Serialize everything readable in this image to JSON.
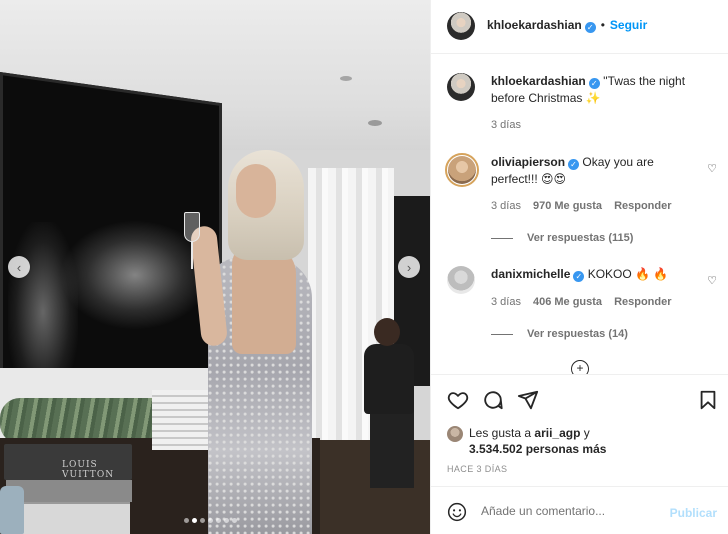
{
  "post": {
    "author": "khloekardashian",
    "follow_label": "Seguir",
    "separator": "•",
    "more_icon": "more-horizontal-icon"
  },
  "photo": {
    "book_text": "LOUIS VUITTON",
    "prev_icon": "chevron-left-icon",
    "next_icon": "chevron-right-icon",
    "prev_glyph": "‹",
    "next_glyph": "›",
    "slide_count": 7,
    "active_slide": 2
  },
  "caption": {
    "username": "khloekardashian",
    "text": "''Twas the night before Christmas ✨",
    "time": "3 días"
  },
  "comments": [
    {
      "username": "oliviapierson",
      "text": "Okay you are perfect!!! 😍😍",
      "time": "3 días",
      "likes": "970 Me gusta",
      "reply_label": "Responder",
      "view_replies": "Ver respuestas (115)"
    },
    {
      "username": "danixmichelle",
      "text": "KOKOO 🔥 🔥",
      "time": "3 días",
      "likes": "406 Me gusta",
      "reply_label": "Responder",
      "view_replies": "Ver respuestas (14)"
    }
  ],
  "load_more_glyph": "+",
  "actions": {
    "like_icon": "heart-icon",
    "comment_icon": "comment-icon",
    "share_icon": "send-icon",
    "save_icon": "bookmark-icon"
  },
  "likes": {
    "prefix": "Les gusta a",
    "user": "arii_agp",
    "joiner": "y",
    "count": "3.534.502 personas más"
  },
  "time_ago": "HACE 3 DÍAS",
  "composer": {
    "placeholder": "Añade un comentario...",
    "publish_label": "Publicar"
  },
  "colors": {
    "accent": "#0095f6",
    "verified": "#3897f0",
    "publish_disabled": "#b2dffc",
    "muted": "#737373"
  }
}
